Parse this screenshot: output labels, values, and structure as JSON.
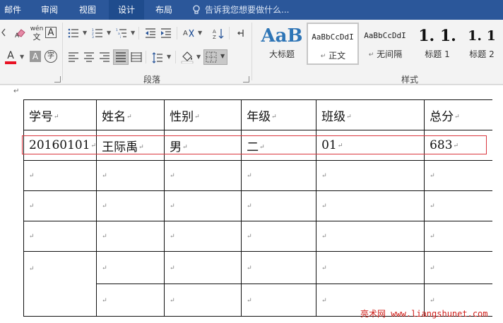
{
  "tabs": [
    {
      "label": "邮件"
    },
    {
      "label": "审阅"
    },
    {
      "label": "视图"
    },
    {
      "label": "设计"
    },
    {
      "label": "布局"
    }
  ],
  "tell_me": "告诉我您想要做什么...",
  "ribbon": {
    "phonetic_top": "wén",
    "phonetic_bottom": "文",
    "char_border": "A",
    "font_color": "A",
    "char_shade": "A",
    "enclose": "字",
    "paragraph_group": "段落",
    "styles_group": "样式",
    "styles": [
      {
        "sample": "AaB",
        "name": "大标题"
      },
      {
        "sample": "AaBbCcDdI",
        "name": "正文"
      },
      {
        "sample": "AaBbCcDdI",
        "name": "无间隔"
      },
      {
        "sample": "1. 1.",
        "name": "标题 1"
      },
      {
        "sample": "1. 1",
        "name": "标题 2"
      }
    ],
    "accent_color": "#2b579a",
    "font_color_swatch": "#e81123"
  },
  "document": {
    "paragraph_mark": "↵",
    "table": {
      "headers": [
        "学号",
        "姓名",
        "性别",
        "年级",
        "班级",
        "总分"
      ],
      "row1": [
        "20160101",
        "王际禹",
        "男",
        "二",
        "01",
        "683"
      ]
    }
  },
  "watermark": "亮术网 www.liangshunet.com"
}
